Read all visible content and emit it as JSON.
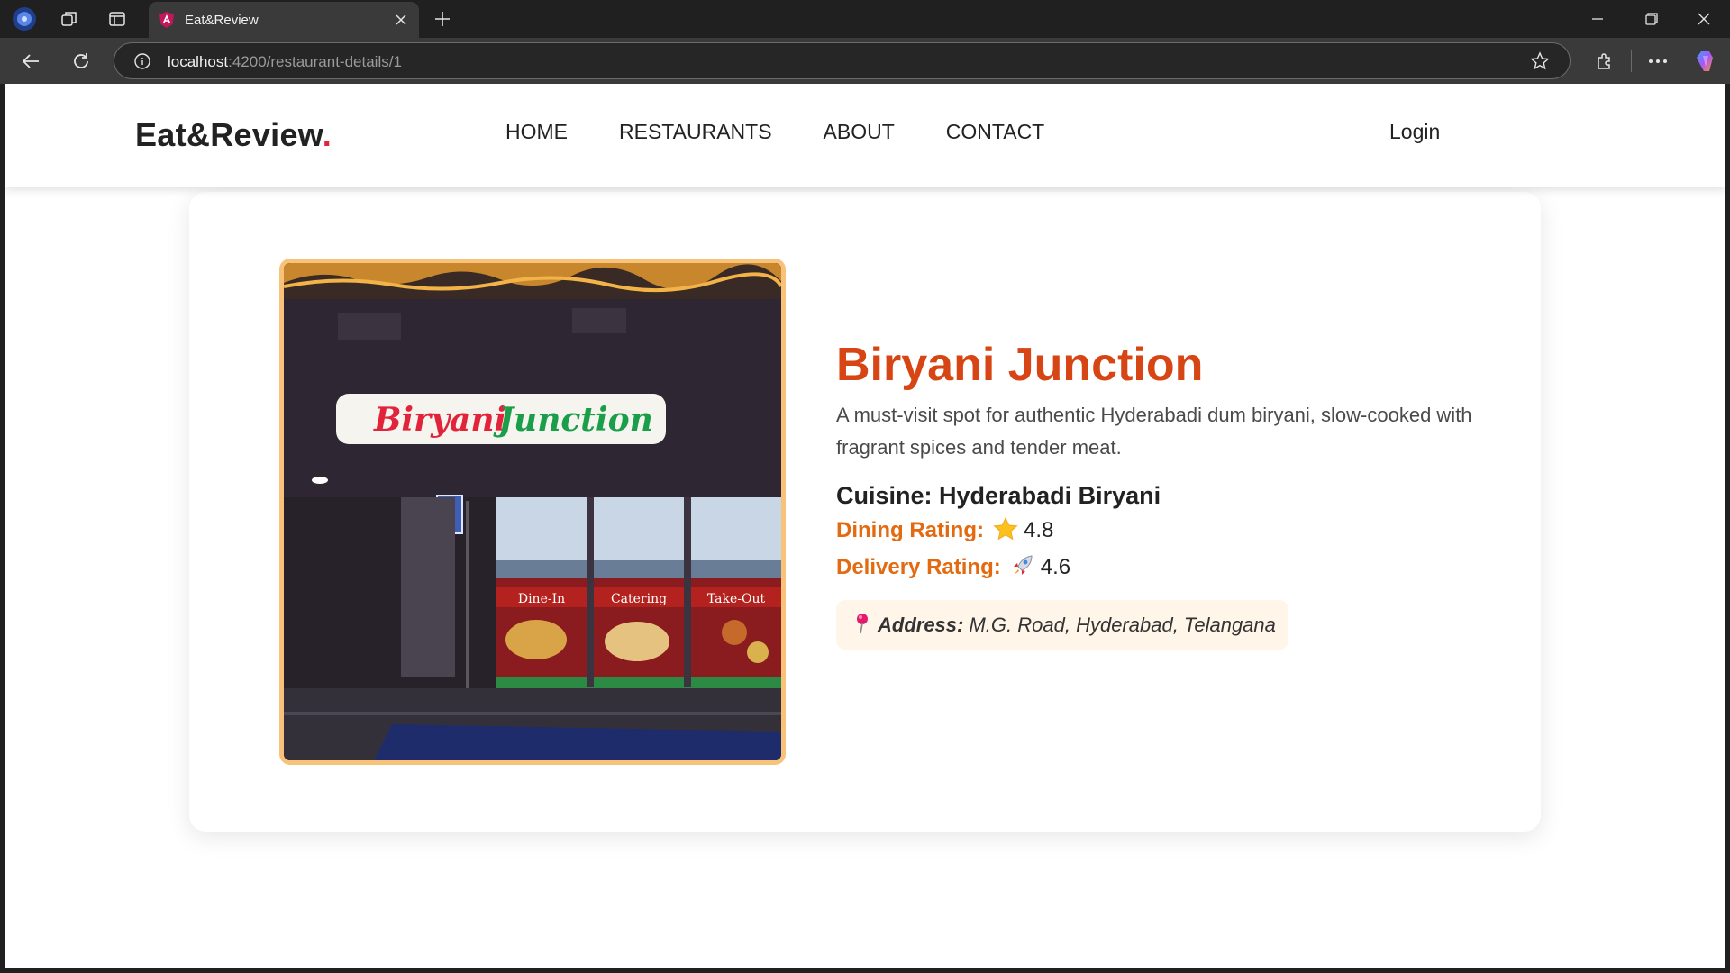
{
  "browser": {
    "tab_title": "Eat&Review",
    "url_host": "localhost",
    "url_path": ":4200/restaurant-details/1"
  },
  "site": {
    "logo_text": "Eat&Review",
    "logo_dot": ".",
    "nav": [
      "HOME",
      "RESTAURANTS",
      "ABOUT",
      "CONTACT"
    ],
    "login_label": "Login"
  },
  "restaurant": {
    "name": "Biryani Junction",
    "description": "A must-visit spot for authentic Hyderabadi dum biryani, slow-cooked with fragrant spices and tender meat.",
    "cuisine_label": "Cuisine:",
    "cuisine": "Hyderabadi Biryani",
    "dining_label": "Dining Rating:",
    "dining_rating": "4.8",
    "delivery_label": "Delivery Rating:",
    "delivery_rating": "4.6",
    "address_label": "Address:",
    "address": "M.G. Road, Hyderabad, Telangana",
    "photo": {
      "sign_left": "Biryani",
      "sign_right": "Junction",
      "window_labels": [
        "Dine-In",
        "Catering",
        "Take-Out"
      ]
    }
  },
  "colors": {
    "accent": "#d64513",
    "rating_label": "#e36a10",
    "logo_dot": "#e2243b",
    "image_border": "#f9c27a",
    "address_bg": "#fff5e9"
  },
  "icons": {
    "dining": "star-icon",
    "delivery": "rocket-icon",
    "address": "pushpin-icon"
  }
}
